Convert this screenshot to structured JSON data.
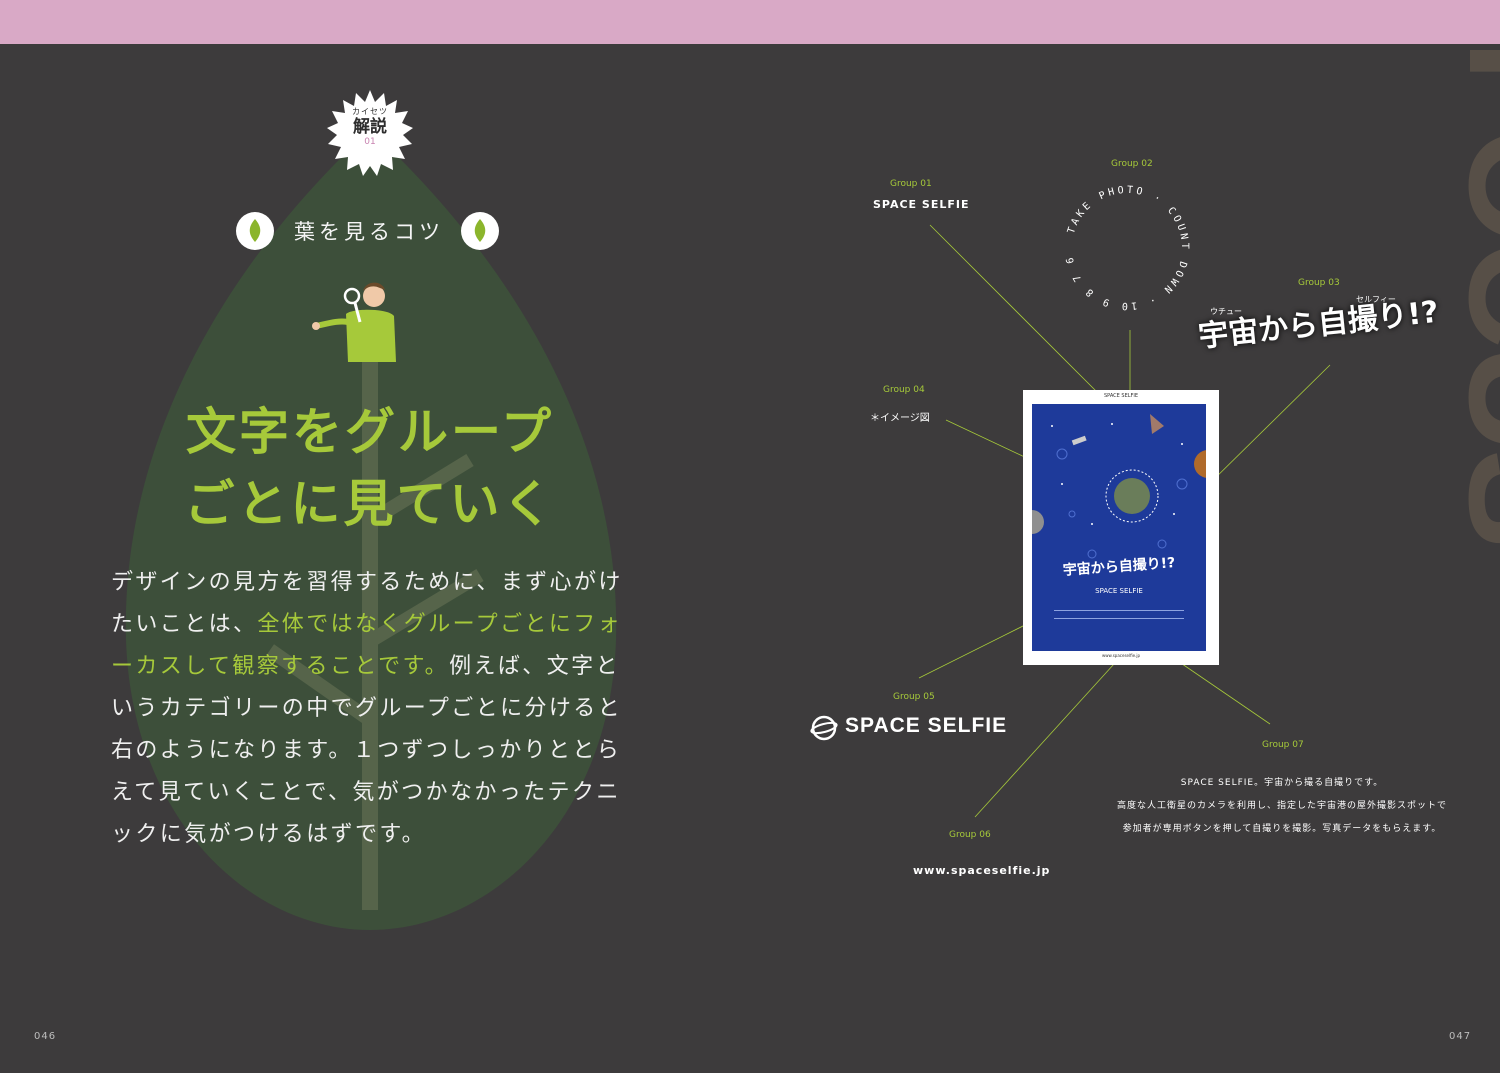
{
  "page": {
    "left_number": "046",
    "right_number": "047"
  },
  "badge": {
    "small": "カイセツ",
    "big": "解説",
    "num": "01"
  },
  "tips_title": "葉を見るコツ",
  "headline": {
    "line1": "文字をグループ",
    "line2": "ごとに見ていく"
  },
  "body": {
    "p1": "デザインの見方を習得するために、まず心がけたいことは、",
    "highlight": "全体ではなくグループごとにフォーカスして観察することです。",
    "p2": "例えば、文字というカテゴリーの中でグループごとに分けると右のようになります。１つずつしっかりととらえて見ていくことで、気がつかなかったテクニックに気がつけるはずです。"
  },
  "focus_word": "FOCUS",
  "groups": {
    "g01": {
      "label": "Group 01",
      "text": "SPACE SELFIE"
    },
    "g02": {
      "label": "Group 02",
      "arc_top": "TAKE PHOTO",
      "arc_right": "COUNT DOWN",
      "arc_bottom": "10 9 8 7 6 5 4 3 2 1"
    },
    "g03": {
      "label": "Group 03",
      "ruby1": "ウチュー",
      "ruby2": "セルフィー",
      "text": "宇宙から自撮り!?"
    },
    "g04": {
      "label": "Group 04",
      "text": "＊イメージ図"
    },
    "g05": {
      "label": "Group 05",
      "text": "SPACE SELFIE"
    },
    "g06": {
      "label": "Group 06",
      "text": "www.spaceselfie.jp"
    },
    "g07": {
      "label": "Group 07",
      "line1": "SPACE SELFIE。宇宙から撮る自撮りです。",
      "line2": "高度な人工衛星のカメラを利用し、指定した宇宙港の屋外撮影スポットで",
      "line3": "参加者が専用ボタンを押して自撮りを撮影。写真データをもらえます。"
    }
  },
  "poster": {
    "top": "SPACE SELFIE",
    "title": "宇宙から自撮り!?",
    "brand": "SPACE SELFIE",
    "url": "www.spaceselfie.jp"
  },
  "colors": {
    "accent": "#a6c93a",
    "background": "#3d3b3c",
    "band": "#d9a9c6",
    "poster_blue": "#1e3a9a"
  }
}
